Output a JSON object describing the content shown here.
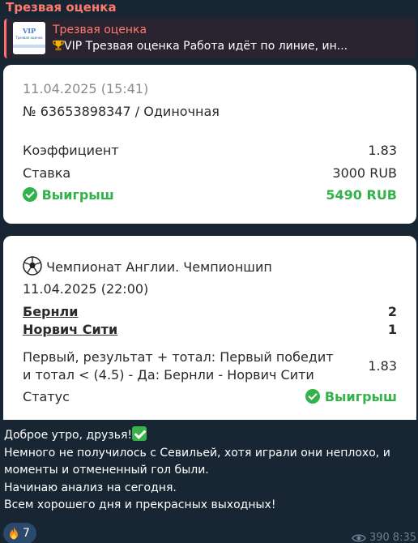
{
  "message": {
    "sender": "Трезвая оценка",
    "reply": {
      "title": "Трезвая оценка",
      "text": "VIP Трезвая оценка  Работа идёт по линие, ин...",
      "thumb_text": "VIP",
      "thumb_sub": "Трезвая оценка"
    },
    "bet_card": {
      "date": "11.04.2025 (15:41)",
      "number": "№ 63653898347 / Одиночная",
      "coef_label": "Коэффициент",
      "coef_value": "1.83",
      "stake_label": "Ставка",
      "stake_value": "3000 RUB",
      "win_label": "Выигрыш",
      "win_value": "5490 RUB"
    },
    "event_card": {
      "league": "Чемпионат Англии. Чемпионшип",
      "date": "11.04.2025 (22:00)",
      "team1": "Бернли",
      "score1": "2",
      "team2": "Норвич Сити",
      "score2": "1",
      "market_line1": "Первый, результат + тотал: Первый победит",
      "market_line2": "и тотал < (4.5) - Да: Бернли - Норвич Сити",
      "market_coef": "1.83",
      "status_label": "Статус",
      "status_value": "Выигрыш"
    },
    "text_lines": [
      "Доброе утро, друзья!",
      "Немного не получилось с Севильей, хотя играли они неплохо, и",
      "моменты и отмененный гол были.",
      "Начинаю анализ на сегодня.",
      "Всем хорошего дня и прекрасных выходных!"
    ],
    "reaction_count": "7",
    "views": "390",
    "time": "8:35"
  },
  "colors": {
    "background": "#182533",
    "sender": "#ff7a6e",
    "win_green": "#33b24b",
    "reaction_bg": "#2b4a6b"
  },
  "icons": [
    "trophy-icon",
    "check-circle-icon",
    "soccer-ball-icon",
    "check-mark-emoji-icon",
    "fire-icon",
    "eye-icon"
  ]
}
